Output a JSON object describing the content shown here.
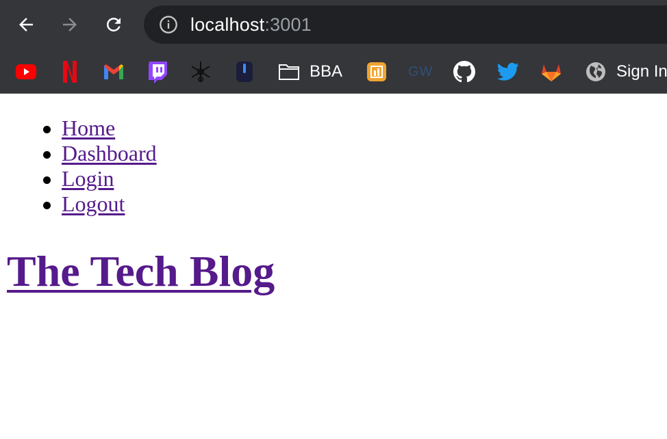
{
  "browser": {
    "url_host": "localhost",
    "url_port": ":3001",
    "bookmarks": [
      {
        "icon": "youtube-icon"
      },
      {
        "icon": "netflix-icon"
      },
      {
        "icon": "gmail-icon"
      },
      {
        "icon": "twitch-icon"
      },
      {
        "icon": "snowflake-icon"
      },
      {
        "icon": "app-icon"
      },
      {
        "icon": "folder-icon",
        "label": "BBA"
      },
      {
        "icon": "chart-app-icon"
      },
      {
        "icon": "gw-icon",
        "text": "GW"
      },
      {
        "icon": "github-icon"
      },
      {
        "icon": "twitter-icon"
      },
      {
        "icon": "gitlab-icon"
      },
      {
        "icon": "globe-icon",
        "label": "Sign In"
      }
    ],
    "colors": {
      "chrome": "#35363a",
      "omnibox": "#202124"
    }
  },
  "nav": {
    "items": [
      "Home",
      "Dashboard",
      "Login",
      "Logout"
    ]
  },
  "page": {
    "title": "The Tech Blog",
    "link_color": "#551a8b"
  }
}
